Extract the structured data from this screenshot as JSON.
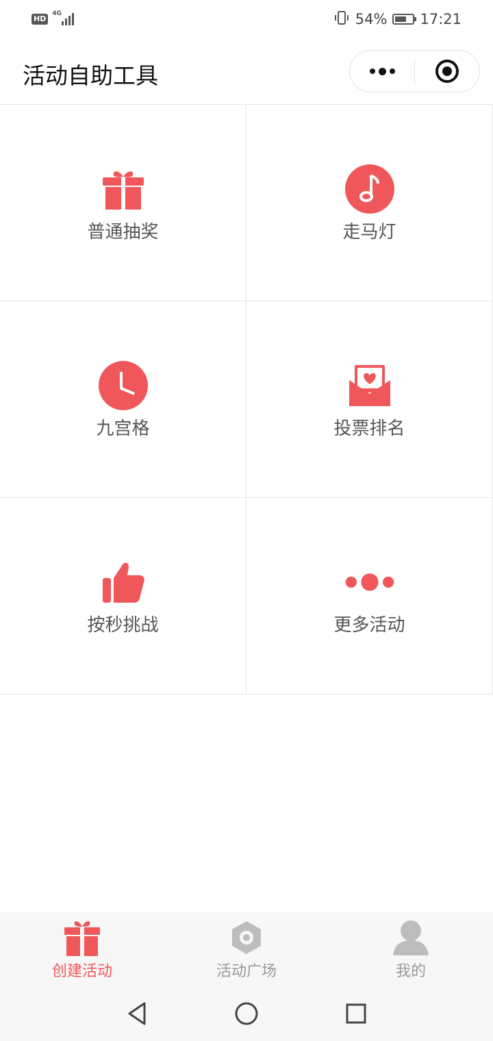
{
  "status_bar": {
    "hd": "HD",
    "network": "4G",
    "battery_percent": "54%",
    "battery_level": 0.54,
    "time": "17:21"
  },
  "header": {
    "title": "活动自助工具",
    "menu_icon": "more-dots-icon",
    "close_icon": "target-icon"
  },
  "grid": {
    "accent_color": "#f0575b",
    "items": [
      {
        "label": "普通抽奖",
        "icon": "gift-icon"
      },
      {
        "label": "走马灯",
        "icon": "music-note-icon"
      },
      {
        "label": "九宫格",
        "icon": "clock-icon"
      },
      {
        "label": "投票排名",
        "icon": "heart-envelope-icon"
      },
      {
        "label": "按秒挑战",
        "icon": "thumbs-up-icon"
      },
      {
        "label": "更多活动",
        "icon": "more-dots-icon"
      }
    ]
  },
  "tabbar": {
    "active_color": "#f0575b",
    "inactive_color": "#999999",
    "tabs": [
      {
        "label": "创建活动",
        "icon": "gift-icon",
        "active": true
      },
      {
        "label": "活动广场",
        "icon": "hexagon-icon",
        "active": false
      },
      {
        "label": "我的",
        "icon": "user-icon",
        "active": false
      }
    ]
  },
  "navbar": {
    "back": "back-triangle-icon",
    "home": "home-circle-icon",
    "recents": "recents-square-icon"
  }
}
